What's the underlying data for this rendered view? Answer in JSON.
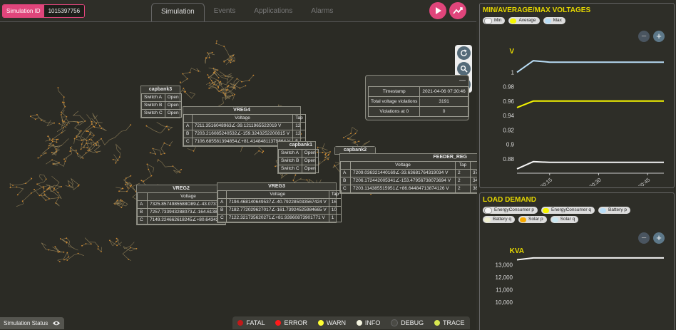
{
  "topbar": {
    "sim_id_label": "Simulation ID",
    "sim_id_value": "1015397756",
    "tabs": [
      {
        "label": "Simulation",
        "active": true
      },
      {
        "label": "Events",
        "active": false
      },
      {
        "label": "Applications",
        "active": false
      },
      {
        "label": "Alarms",
        "active": false
      }
    ],
    "play_icon": "play-icon",
    "chart_icon": "line-chart-icon",
    "accent": "#e0457b"
  },
  "map_controls": {
    "refresh_icon": "refresh-icon",
    "zoom_icon": "magnifier-icon",
    "pan_icon": "pan-arrows-icon"
  },
  "capbank3": {
    "title": "capbank3",
    "rows": [
      [
        "Switch A",
        "Open"
      ],
      [
        "Switch B",
        "Open"
      ],
      [
        "Switch C",
        "Open"
      ]
    ]
  },
  "vreg4": {
    "title": "VREG4",
    "header": [
      "",
      "Voltage",
      "Tap"
    ],
    "rows": [
      [
        "A",
        "7211.3516048963∠-39.1211965522019 V",
        "12"
      ],
      [
        "B",
        "7203.216085240532∠-159.3243252200815 V",
        "12"
      ],
      [
        "C",
        "7106.685581394854∠+81.41484811379864 V",
        "5"
      ]
    ]
  },
  "capbank1": {
    "title": "capbank1",
    "rows": [
      [
        "Switch A",
        "Open"
      ],
      [
        "Switch B",
        "Open"
      ],
      [
        "Switch C",
        "Open"
      ]
    ]
  },
  "capbank2": {
    "title": "capbank2"
  },
  "feeder_reg": {
    "title": "FEEDER_REG",
    "header": [
      "",
      "Voltage",
      "Tap",
      ""
    ],
    "rows": [
      [
        "A",
        "7209.036321440169∠-33.63681764319034 V",
        "2",
        "3709"
      ],
      [
        "B",
        "7206.172442005341∠-153.47956738073694 V",
        "2",
        "34386"
      ],
      [
        "C",
        "7203.114385515951∠+86.64484713874126 V",
        "2",
        "36948"
      ]
    ]
  },
  "violations": {
    "rows": [
      [
        "Timestamp",
        "2021-04-06 07:30:46"
      ],
      [
        "Total voltage violations",
        "3191"
      ],
      [
        "Violations at 0",
        "0"
      ]
    ]
  },
  "vreg2": {
    "title": "VREG2",
    "header": [
      "",
      "Voltage"
    ],
    "rows": [
      [
        "A",
        "7325.8574985588O89∠-43.0737257"
      ],
      [
        "B",
        "7257.733943288073∠-164.613813"
      ],
      [
        "C",
        "7149.224662618245∠+80.643422"
      ]
    ]
  },
  "vreg3": {
    "title": "VREG3",
    "header": [
      "",
      "Voltage",
      "Tap"
    ],
    "rows": [
      [
        "A",
        "7194.468140649537∠-40.792285033567424 V",
        "16"
      ],
      [
        "B",
        "7182.772029627017∠-161.73924525984665 V",
        "10"
      ],
      [
        "C",
        "7122.321735620271∠+81.93960873901771 V",
        "1"
      ]
    ]
  },
  "status": {
    "label": "Simulation Status",
    "icon": "eye-icon"
  },
  "log_levels": [
    {
      "label": "FATAL",
      "color": "#c21a1a"
    },
    {
      "label": "ERROR",
      "color": "#ff1a1a"
    },
    {
      "label": "WARN",
      "color": "#ffff33"
    },
    {
      "label": "INFO",
      "color": "#f4f4e0"
    },
    {
      "label": "DEBUG",
      "color": "#4a4a44"
    },
    {
      "label": "TRACE",
      "color": "#d8e850"
    }
  ],
  "voltage_chart": {
    "panel_title": "MIN/AVERAGE/MAX VOLTAGES",
    "legend": [
      {
        "name": "Min",
        "color": "#f4f4f4"
      },
      {
        "name": "Average",
        "color": "#f5f500"
      },
      {
        "name": "Max",
        "color": "#b8dcf5"
      }
    ],
    "minus": "−",
    "plus": "+",
    "ylabel": "V"
  },
  "demand_chart": {
    "panel_title": "LOAD DEMAND",
    "legend": [
      {
        "name": "EnergyConsumer p",
        "color": "#f4f4f4"
      },
      {
        "name": "EnergyConsumer q",
        "color": "#f5f500"
      },
      {
        "name": "Battery p",
        "color": "#b8dcf5"
      },
      {
        "name": "Battery q",
        "color": "#f0f0d0"
      },
      {
        "name": "Solar p",
        "color": "#f5a800"
      },
      {
        "name": "Solar q",
        "color": "#c8e6f0"
      }
    ],
    "minus": "−",
    "plus": "+",
    "ylabel": "KVA"
  },
  "chart_data": [
    {
      "type": "line",
      "title": "MIN/AVERAGE/MAX VOLTAGES",
      "ylabel": "V",
      "ylim": [
        0.86,
        1.03
      ],
      "yticks": [
        1,
        0.98,
        0.96,
        0.94,
        0.92,
        0.9,
        0.88
      ],
      "x": [
        "07:30:10",
        "07:30:12",
        "07:30:15",
        "07:30:20",
        "07:30:25",
        "07:30:30",
        "07:30:35",
        "07:30:40",
        "07:30:45",
        "07:30:50"
      ],
      "xticks": [
        "07:30:15",
        "07:30:30",
        "07:30:45"
      ],
      "series": [
        {
          "name": "Max",
          "color": "#b8dcf5",
          "values": [
            1.0,
            1.016,
            1.014,
            1.014,
            1.014,
            1.014,
            1.014,
            1.014,
            1.014,
            1.014
          ]
        },
        {
          "name": "Average",
          "color": "#f5f500",
          "values": [
            0.951,
            0.96,
            0.96,
            0.96,
            0.96,
            0.96,
            0.96,
            0.96,
            0.96,
            0.96
          ]
        },
        {
          "name": "Min",
          "color": "#f4f4f4",
          "values": [
            0.866,
            0.876,
            0.875,
            0.875,
            0.875,
            0.875,
            0.875,
            0.875,
            0.875,
            0.875
          ]
        }
      ]
    },
    {
      "type": "line",
      "title": "LOAD DEMAND",
      "ylabel": "KVA",
      "ylim": [
        9700,
        13600
      ],
      "yticks": [
        "13,000",
        "12,000",
        "11,000",
        "10,000"
      ],
      "ytick_values": [
        13000,
        12000,
        11000,
        10000
      ],
      "x": [
        "07:30:10",
        "07:30:12",
        "07:30:15",
        "07:30:20",
        "07:30:25",
        "07:30:30",
        "07:30:35",
        "07:30:40",
        "07:30:45",
        "07:30:50"
      ],
      "series": [
        {
          "name": "EnergyConsumer p",
          "color": "#f4f4f4",
          "values": [
            13400,
            13550,
            13550,
            13550,
            13550,
            13550,
            13550,
            13550,
            13550,
            13550
          ]
        }
      ]
    }
  ]
}
